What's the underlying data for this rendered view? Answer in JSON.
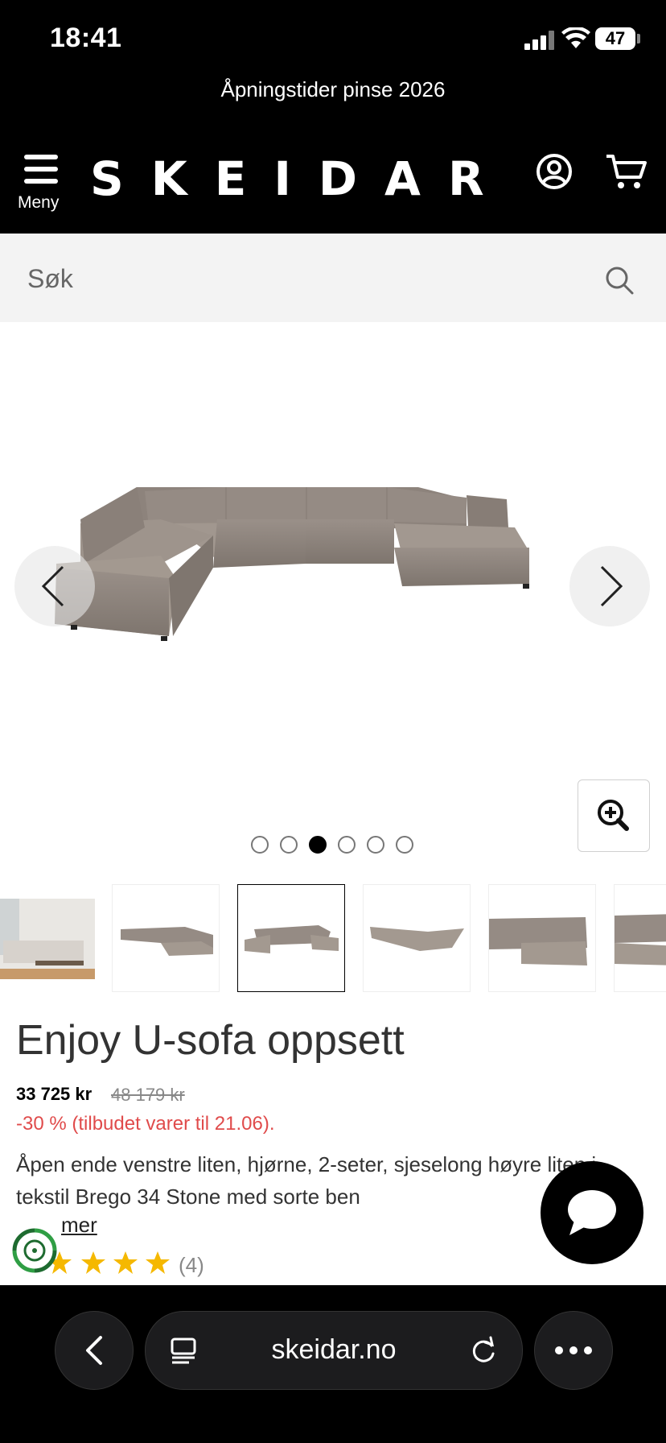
{
  "status_bar": {
    "time": "18:41",
    "battery": "47"
  },
  "banner": {
    "text": "Åpningstider pinse 2026"
  },
  "header": {
    "menu_label": "Meny",
    "logo": "SKEIDAR"
  },
  "search": {
    "placeholder": "Søk"
  },
  "gallery": {
    "dot_count": 6,
    "active_dot": 2,
    "thumbnail_count": 6,
    "selected_thumbnail": 2
  },
  "product": {
    "title": "Enjoy U-sofa oppsett",
    "price": "33 725 kr",
    "old_price": "48 179 kr",
    "discount": "-30 % (tilbudet varer til 21.06).",
    "description": "Åpen ende venstre liten, hjørne, 2-seter, sjeselong høyre liten i tekstil Brego 34 Stone med sorte ben",
    "read_more": "mer",
    "rating": 5,
    "review_count": "(4)"
  },
  "browser": {
    "url": "skeidar.no"
  },
  "colors": {
    "header_bg": "#000000",
    "search_bg": "#f3f3f3",
    "discount": "#e04b4b",
    "star": "#f5b800",
    "sofa": "#8f857d"
  }
}
